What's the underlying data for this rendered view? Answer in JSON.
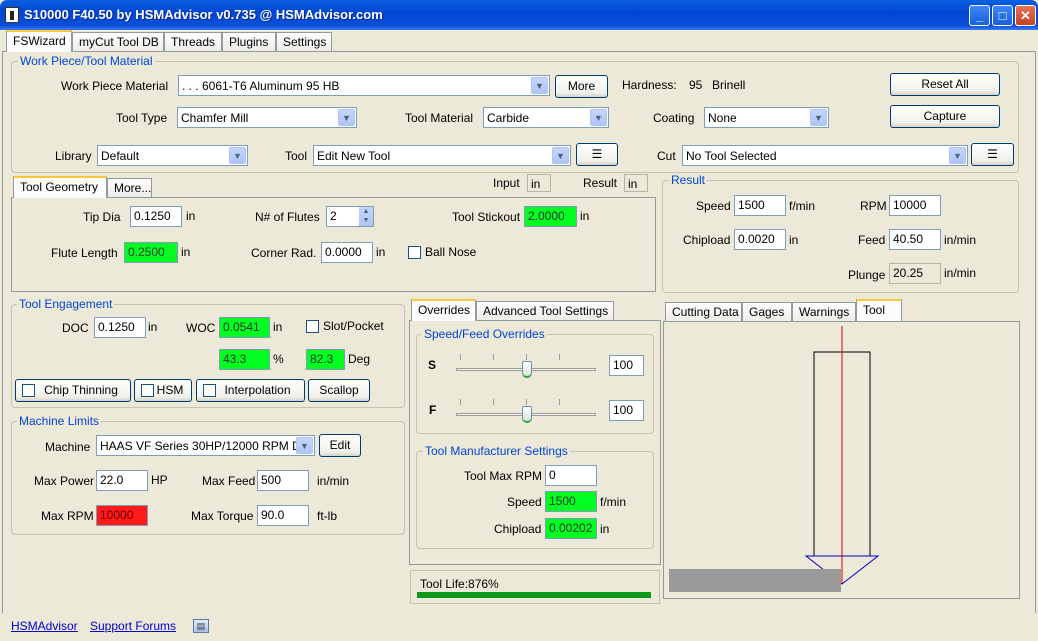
{
  "window": {
    "title": "S10000 F40.50 by HSMAdvisor v0.735 @ HSMAdvisor.com"
  },
  "main_tabs": [
    "FSWizard",
    "myCut Tool DB",
    "Threads",
    "Plugins",
    "Settings"
  ],
  "workpiece": {
    "title": "Work Piece/Tool Material",
    "material_label": "Work Piece Material",
    "material_value": ". . . 6061-T6 Aluminum 95 HB",
    "more_button": "More",
    "hardness_label": "Hardness:",
    "hardness_value": "95",
    "hardness_unit": "Brinell",
    "reset_button": "Reset All",
    "capture_button": "Capture",
    "tool_type_label": "Tool Type",
    "tool_type_value": "Chamfer Mill",
    "tool_material_label": "Tool Material",
    "tool_material_value": "Carbide",
    "coating_label": "Coating",
    "coating_value": "None",
    "library_label": "Library",
    "library_value": "Default",
    "tool_label": "Tool",
    "tool_value": "Edit New Tool",
    "cut_label": "Cut",
    "cut_value": "No Tool Selected"
  },
  "geometry": {
    "tabs": [
      "Tool Geometry",
      "More..."
    ],
    "input_label": "Input",
    "input_unit": "in",
    "result_label": "Result",
    "result_unit": "in",
    "tip_dia_label": "Tip Dia",
    "tip_dia_value": "0.1250",
    "tip_dia_unit": "in",
    "flutes_label": "N# of Flutes",
    "flutes_value": "2",
    "stickout_label": "Tool Stickout",
    "stickout_value": "2.0000",
    "stickout_unit": "in",
    "flute_length_label": "Flute Length",
    "flute_length_value": "0.2500",
    "flute_length_unit": "in",
    "corner_rad_label": "Corner Rad.",
    "corner_rad_value": "0.0000",
    "corner_rad_unit": "in",
    "ball_nose_label": "Ball Nose"
  },
  "result": {
    "title": "Result",
    "speed_label": "Speed",
    "speed_value": "1500",
    "speed_unit": "f/min",
    "rpm_label": "RPM",
    "rpm_value": "10000",
    "chipload_label": "Chipload",
    "chipload_value": "0.0020",
    "chipload_unit": "in",
    "feed_label": "Feed",
    "feed_value": "40.50",
    "feed_unit": "in/min",
    "plunge_label": "Plunge",
    "plunge_value": "20.25",
    "plunge_unit": "in/min"
  },
  "engagement": {
    "title": "Tool Engagement",
    "doc_label": "DOC",
    "doc_value": "0.1250",
    "doc_unit": "in",
    "woc_label": "WOC",
    "woc_value": "0.0541",
    "woc_unit": "in",
    "slot_label": "Slot/Pocket",
    "pct_value": "43.3",
    "pct_unit": "%",
    "deg_value": "82.3",
    "deg_unit": "Deg",
    "chip_thinning": "Chip Thinning",
    "hsm": "HSM",
    "interpolation": "Interpolation",
    "scallop": "Scallop"
  },
  "machine": {
    "title": "Machine Limits",
    "machine_label": "Machine",
    "machine_value": "HAAS VF Series 30HP/12000 RPM D",
    "edit_button": "Edit",
    "max_power_label": "Max Power",
    "max_power_value": "22.0",
    "max_power_unit": "HP",
    "max_feed_label": "Max Feed",
    "max_feed_value": "500",
    "max_feed_unit": "in/min",
    "max_rpm_label": "Max RPM",
    "max_rpm_value": "10000",
    "max_torque_label": "Max Torque",
    "max_torque_value": "90.0",
    "max_torque_unit": "ft-lb"
  },
  "overrides": {
    "tabs": [
      "Overrides",
      "Advanced Tool Settings"
    ],
    "title": "Speed/Feed Overrides",
    "s_label": "S",
    "s_value": "100",
    "f_label": "F",
    "f_value": "100",
    "s_slider_fraction": 0.5,
    "f_slider_fraction": 0.5
  },
  "manufacturer": {
    "title": "Tool Manufacturer Settings",
    "max_rpm_label": "Tool Max RPM",
    "max_rpm_value": "0",
    "speed_label": "Speed",
    "speed_value": "1500",
    "speed_unit": "f/min",
    "chipload_label": "Chipload",
    "chipload_value": "0.00202",
    "chipload_unit": "in"
  },
  "tool_life": {
    "label": "Tool Life:876%",
    "bar_fraction": 1.0
  },
  "right_tabs": [
    "Cutting Data",
    "Gages",
    "Warnings",
    "Tool"
  ],
  "status_links": {
    "hsmadvisor": "HSMAdvisor",
    "support": "Support Forums"
  },
  "colors": {
    "good": "#00ff20",
    "warn": "#ff1a1a",
    "accent": "#0046d5"
  }
}
